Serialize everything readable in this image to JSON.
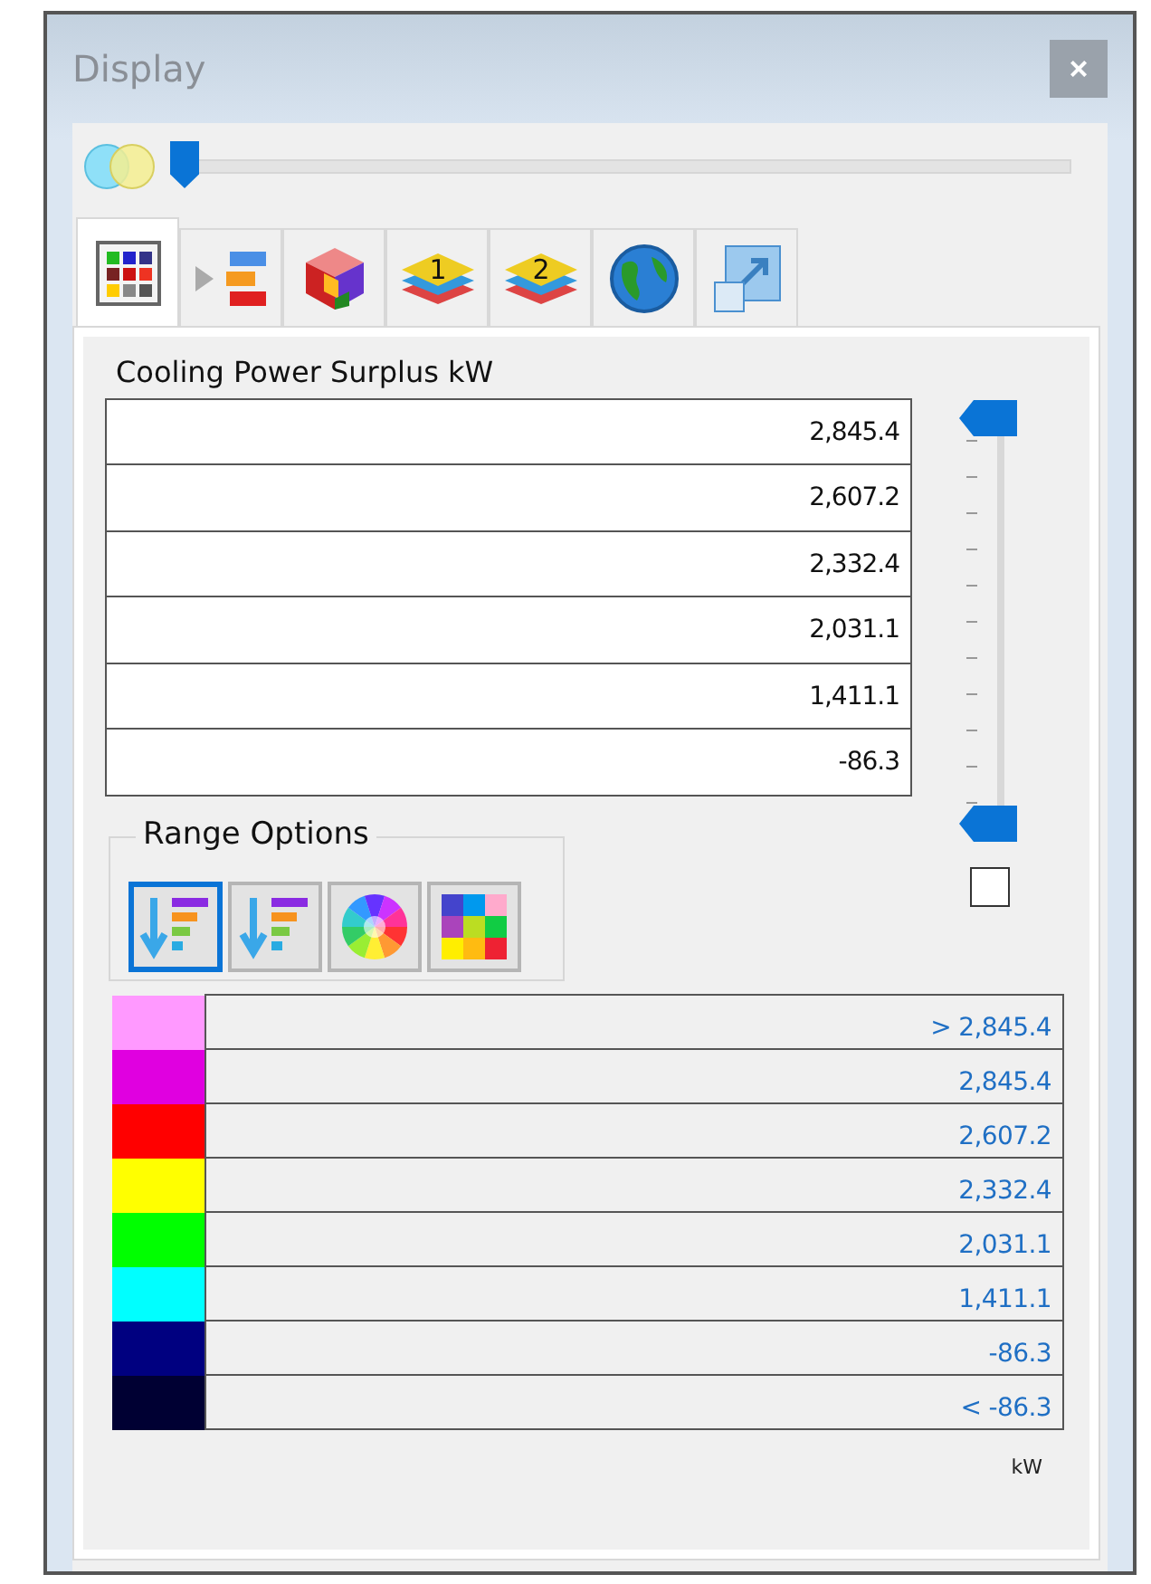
{
  "window": {
    "title": "Display",
    "close": "×"
  },
  "blend_slider": {
    "level": 0
  },
  "tabs": [
    {
      "kind": "grid",
      "selected": true
    },
    {
      "kind": "list",
      "selected": false
    },
    {
      "kind": "cube",
      "selected": false
    },
    {
      "kind": "layer1",
      "label": "1",
      "selected": false
    },
    {
      "kind": "layer2",
      "label": "2",
      "selected": false
    },
    {
      "kind": "globe",
      "selected": false
    },
    {
      "kind": "resize",
      "selected": false
    }
  ],
  "field": {
    "title": "Cooling Power Surplus kW"
  },
  "values": [
    "2,845.4",
    "2,607.2",
    "2,332.4",
    "2,031.1",
    "1,411.1",
    "-86.3"
  ],
  "range_slider": {
    "upper": {
      "level": 1
    },
    "lower": {
      "level": 0
    }
  },
  "lock_checkbox": {
    "checked": false
  },
  "range_options": {
    "title": "Range Options",
    "buttons": [
      {
        "kind": "ramp",
        "selected": true
      },
      {
        "kind": "ramp",
        "selected": false
      },
      {
        "kind": "wheel",
        "selected": false
      },
      {
        "kind": "palette",
        "selected": false
      }
    ]
  },
  "legend": [
    {
      "color": "#ff99ff",
      "label": "> 2,845.4"
    },
    {
      "color": "#e000e0",
      "label": "2,845.4"
    },
    {
      "color": "#ff0000",
      "label": "2,607.2"
    },
    {
      "color": "#ffff00",
      "label": "2,332.4"
    },
    {
      "color": "#00ff00",
      "label": "2,031.1"
    },
    {
      "color": "#00ffff",
      "label": "1,411.1"
    },
    {
      "color": "#000080",
      "label": "-86.3"
    },
    {
      "color": "#000033",
      "label": "< -86.3"
    }
  ],
  "unit": "kW"
}
